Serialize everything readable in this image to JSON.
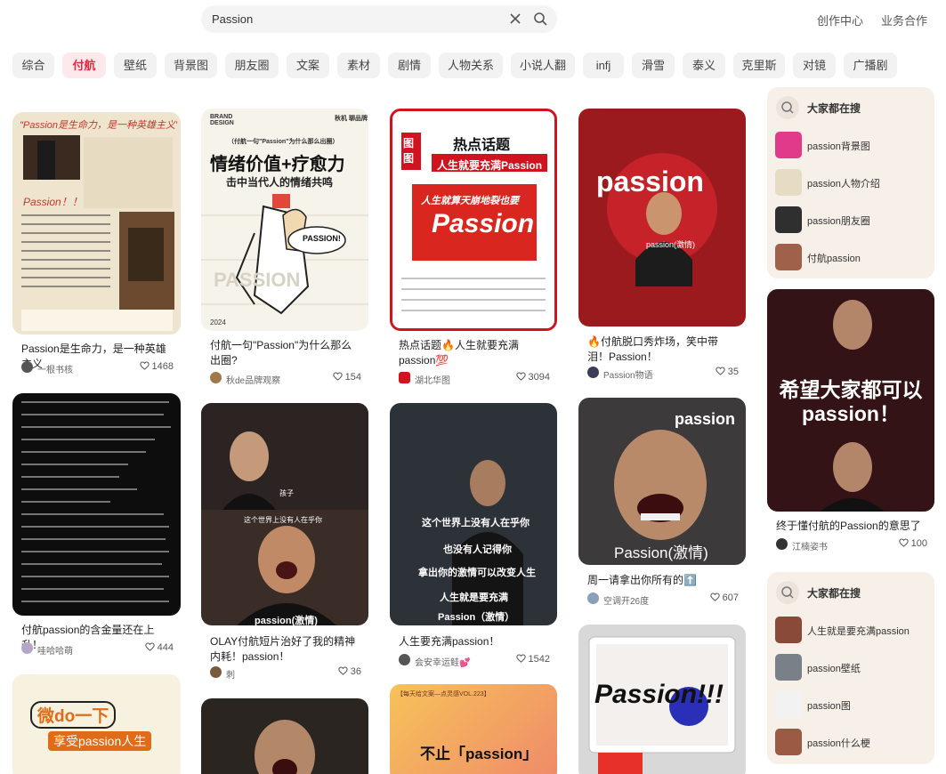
{
  "search": {
    "query": "Passion"
  },
  "header": {
    "links": [
      "创作中心",
      "业务合作"
    ]
  },
  "tabs": [
    "综合",
    "付航",
    "壁纸",
    "背景图",
    "朋友圈",
    "文案",
    "素材",
    "剧情",
    "人物关系",
    "小说人翻",
    "infj",
    "滑雪",
    "泰义",
    "克里斯",
    "对镜",
    "广播剧"
  ],
  "active_tab": "付航",
  "cards": [
    {
      "title": "Passion是生命力，是一种英雄主义",
      "author": "一根书核",
      "likes": "1468",
      "cover_text": [
        "\"Passion是生命力，是一种英雄主义\"",
        "Passion！！"
      ]
    },
    {
      "title": "付航一句\"Passion\"为什么那么出圈?",
      "author": "秋de品牌观察",
      "likes": "154",
      "cover_text": [
        "BRAND DESIGN",
        "秋机 聊品牌",
        "（付航一句\"Passion\"为什么那么出圈）",
        "情绪价值+疗愈力",
        "击中当代人的情绪共鸣",
        "PASSION!",
        "2024",
        "PASSION"
      ]
    },
    {
      "title": "热点话题🔥人生就要充满passion💯",
      "author": "湖北华图",
      "likes": "3094",
      "cover_text": [
        "图图",
        "热点话题",
        "人生就要充满Passion",
        "人生就算天崩地裂也要",
        "Passion"
      ]
    },
    {
      "title": "🔥付航脱口秀炸场，笑中带泪！Passion！",
      "author": "Passion物语",
      "likes": "35",
      "cover_text": [
        "passion",
        "passion(激情)"
      ]
    },
    {
      "title": "付航passion的含金量还在上升！",
      "author": "哇哈哈萌",
      "likes": "444",
      "cover_text": []
    },
    {
      "title": "OLAY付航短片治好了我的精神内耗！passion！",
      "author": "刺",
      "likes": "36",
      "cover_text": [
        "孩子",
        "这个世界上没有人在乎你",
        "passion(激情)"
      ]
    },
    {
      "title": "人生要充满passion！",
      "author": "会安幸运鲑💕",
      "likes": "1542",
      "cover_text": [
        "这个世界上没有人在乎你",
        "也没有人记得你",
        "拿出你的激情可以改变人生",
        "人生就是要充满",
        "Passion（激情）"
      ]
    },
    {
      "title": "周一请拿出你所有的⬆️",
      "author": "空调开26度",
      "likes": "607",
      "cover_text": [
        "passion",
        "Passion(激情)"
      ]
    },
    {
      "title": "终于懂付航的Passion的意思了",
      "author": "江楠姿书",
      "likes": "100",
      "cover_text": [
        "希望大家都可以passion！"
      ]
    },
    {
      "title": "",
      "author": "",
      "likes": "",
      "cover_text": [
        "微do一下",
        "享受passion人生"
      ]
    },
    {
      "title": "",
      "author": "",
      "likes": "",
      "cover_text": []
    },
    {
      "title": "",
      "author": "",
      "likes": "",
      "cover_text": [
        "【每天给文案—点灵感VOL.223】",
        "不止「passion」"
      ]
    },
    {
      "title": "",
      "author": "",
      "likes": "",
      "cover_text": [
        "Passion!!!"
      ]
    }
  ],
  "side_panels": [
    {
      "title": "大家都在搜",
      "items": [
        "passion背景图",
        "passion人物介绍",
        "passion朋友圈",
        "付航passion"
      ]
    },
    {
      "title": "大家都在搜",
      "items": [
        "人生就是要充满passion",
        "passion壁纸",
        "passion图",
        "passion什么梗"
      ]
    }
  ],
  "colors": {
    "accent": "#e5293f",
    "panel_bg": "#f7f0e8",
    "tab_bg": "#f2f2f2"
  },
  "icons": {
    "clear": "close-icon",
    "search": "search-icon",
    "like": "heart-icon",
    "panel": "search-icon"
  }
}
